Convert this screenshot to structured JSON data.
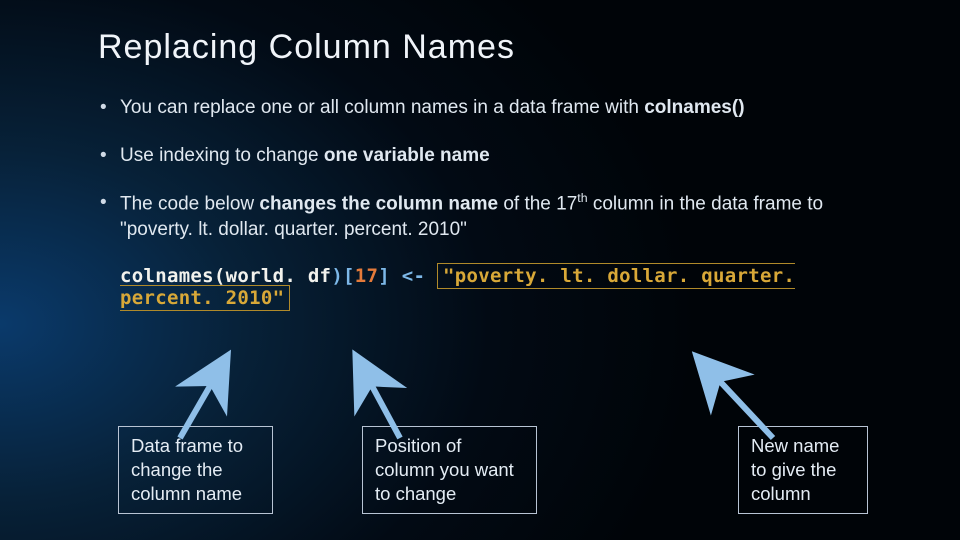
{
  "title": "Replacing Column Names",
  "bullets": {
    "b1_pre": "You can replace one or all column names in a data frame with ",
    "b1_bold": "colnames()",
    "b2_pre": "Use indexing to change ",
    "b2_bold": "one variable name",
    "b3_pre": "The code below ",
    "b3_bold": "changes the column name",
    "b3_mid": " of the 17",
    "b3_sup": "th",
    "b3_end": " column in the data frame to \"poverty. lt. dollar. quarter. percent. 2010\""
  },
  "code": {
    "lhs": "colnames(world. df",
    "idx_open": ")[",
    "num": "17",
    "idx_close": "]",
    "op": " <- ",
    "str": "\"poverty. lt. dollar. quarter. percent. 2010\""
  },
  "labels": {
    "l1": "Data frame to change the column name",
    "l2": "Position of column you want to change",
    "l3": "New name to give the column"
  }
}
